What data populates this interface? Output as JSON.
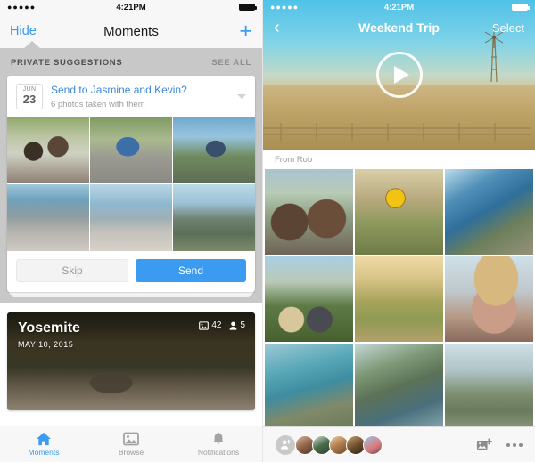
{
  "left": {
    "statusbar": {
      "signal": "●●●●●",
      "time": "4:21PM",
      "battery_icon": "battery-full-icon"
    },
    "navbar": {
      "hide_label": "Hide",
      "title": "Moments",
      "add_icon": "plus-icon"
    },
    "suggestions": {
      "section_title": "PRIVATE SUGGESTIONS",
      "see_all_label": "SEE ALL",
      "card": {
        "date_month": "JUN",
        "date_day": "23",
        "headline": "Send to Jasmine and Kevin?",
        "subtext": "6 photos taken with them",
        "chevron_icon": "chevron-down-icon",
        "photo_count": 6,
        "photos": [
          "two-friends-selfie-outdoors",
          "man-climbing-rock",
          "man-sitting-on-rock-overlook",
          "lake-tahoe-rocky-shore",
          "lake-boulders-clear-water",
          "lake-with-pine-trees"
        ],
        "skip_label": "Skip",
        "send_label": "Send"
      }
    },
    "moment": {
      "name": "Yosemite",
      "date": "MAY 10, 2015",
      "photo_count": "42",
      "people_count": "5",
      "photo_icon": "photo-icon",
      "people_icon": "person-icon"
    },
    "tabs": [
      {
        "label": "Moments",
        "icon": "home-icon",
        "active": true
      },
      {
        "label": "Browse",
        "icon": "photo-icon",
        "active": false
      },
      {
        "label": "Notifications",
        "icon": "bell-icon",
        "active": false
      }
    ]
  },
  "right": {
    "statusbar": {
      "signal": "●●●●●",
      "time": "4:21PM",
      "battery_icon": "battery-full-icon"
    },
    "navbar": {
      "back_icon": "chevron-left-icon",
      "title": "Weekend Trip",
      "select_label": "Select"
    },
    "hero": {
      "media_type": "video",
      "play_icon": "play-icon",
      "description": "windmill-in-golden-field-under-blue-sky"
    },
    "from_label": "From Rob",
    "grid_photos": [
      "couple-selfie-sunglasses-hillside",
      "sunflower-by-wooden-fence",
      "coastal-cliff-ocean-view",
      "couple-hats-overlooking-city",
      "woman-walking-dirt-path-vineyard",
      "woman-white-sunglasses-straw-hat",
      "big-sur-cove-turquoise-water",
      "big-sur-coastline-cliffs",
      "rocky-coastal-overlook"
    ],
    "bottombar": {
      "add_person_icon": "add-person-icon",
      "avatars": [
        "avatar-woman-curly-hair",
        "avatar-woman-sunglasses",
        "avatar-person-outdoors",
        "avatar-person-indoors",
        "avatar-person-blue-shirt"
      ],
      "add_photo_icon": "add-photo-icon",
      "more_icon": "more-dots-icon"
    }
  },
  "colors": {
    "accent_blue": "#3b9bf0",
    "link_blue": "#3b87d8",
    "suggestion_bg": "#c8c8c8",
    "bar_bg": "#f7f7f7",
    "muted_text": "#9a9a9a"
  }
}
